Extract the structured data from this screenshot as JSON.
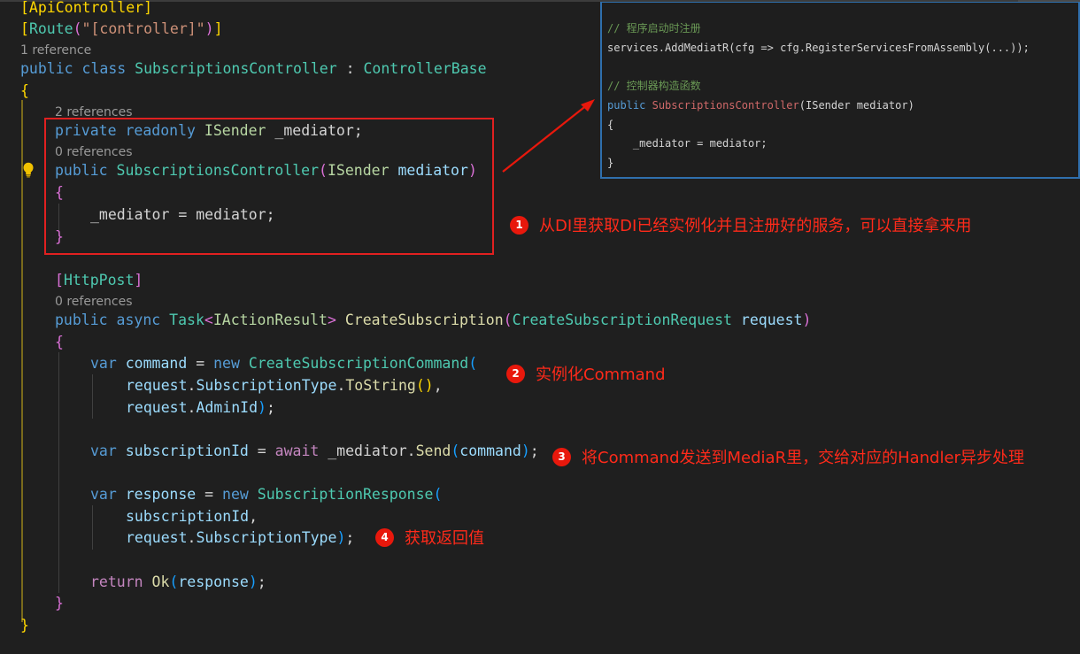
{
  "code": {
    "l1_attr": "[ApiController]",
    "l2_route": "Route",
    "l2_str": "\"[controller]\"",
    "l3_lens": "1 reference",
    "l4_public": "public",
    "l4_class": "class",
    "l4_name": "SubscriptionsController",
    "l4_colon": " : ",
    "l4_base": "ControllerBase",
    "l5_brace": "{",
    "l6_lens": "2 references",
    "l7_private": "private",
    "l7_readonly": "readonly",
    "l7_type": "ISender",
    "l7_field": "_mediator;",
    "l8_lens": "0 references",
    "l9_public": "public",
    "l9_ctor": "SubscriptionsController",
    "l9_ptype": "ISender",
    "l9_pname": "mediator",
    "l10_brace": "{",
    "l11_assign": "_mediator = mediator;",
    "l12_brace": "}",
    "l13_attr": "HttpPost",
    "l14_lens": "0 references",
    "l15_public": "public",
    "l15_async": "async",
    "l15_task": "Task",
    "l15_iar": "IActionResult",
    "l15_method": "CreateSubscription",
    "l15_ptype": "CreateSubscriptionRequest",
    "l15_pname": "request",
    "l16_brace": "{",
    "l17_var": "var",
    "l17_name": "command",
    "l17_new": "new",
    "l17_type": "CreateSubscriptionCommand",
    "l18_req": "request",
    "l18_prop": "SubscriptionType",
    "l18_method": "ToString",
    "l19_req": "request",
    "l19_prop": "AdminId",
    "l20_var": "var",
    "l20_name": "subscriptionId",
    "l20_await": "await",
    "l20_field": "_mediator",
    "l20_send": "Send",
    "l20_arg": "command",
    "l21_var": "var",
    "l21_name": "response",
    "l21_new": "new",
    "l21_type": "SubscriptionResponse",
    "l22_arg": "subscriptionId",
    "l23_req": "request",
    "l23_prop": "SubscriptionType",
    "l24_return": "return",
    "l24_ok": "Ok",
    "l24_arg": "response",
    "l25_brace": "}",
    "l26_brace": "}"
  },
  "popup": {
    "comment1": "// 程序启动时注册",
    "line2": "services.AddMediatR(cfg => cfg.RegisterServicesFromAssembly(...));",
    "comment2": "// 控制器构造函数",
    "ctor_public": "public",
    "ctor_name": "SubscriptionsController",
    "ctor_params": "(ISender mediator)",
    "brace_open": "{",
    "assign": "    _mediator = mediator;",
    "brace_close": "}"
  },
  "annotations": [
    {
      "num": "1",
      "text": "从DI里获取DI已经实例化并且注册好的服务，可以直接拿来用"
    },
    {
      "num": "2",
      "text": "实例化Command"
    },
    {
      "num": "3",
      "text": "将Command发送到MediaR里，交给对应的Handler异步处理"
    },
    {
      "num": "4",
      "text": "获取返回值"
    }
  ],
  "colors": {
    "annotation_red": "#ff2a1a",
    "box_red": "#e02020",
    "popup_border": "#2f6fad",
    "editor_bg": "#1f1f1f"
  },
  "icons": [
    "lightbulb-icon"
  ]
}
